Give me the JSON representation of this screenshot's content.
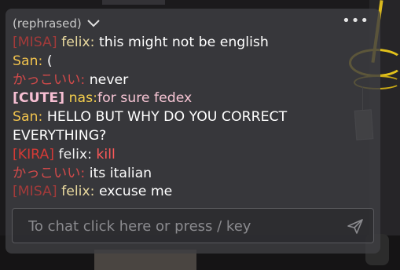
{
  "chat": {
    "header_label": "(rephrased)",
    "messages": [
      {
        "tag": "[MISA]",
        "name": "felix:",
        "text": "this might not be english"
      },
      {
        "tag": "",
        "name": "San:",
        "text": "("
      },
      {
        "tag": "",
        "name": "かっこいい:",
        "text": "never"
      },
      {
        "tag": "[CUTE]",
        "name": "nas:",
        "text": "for sure fedex"
      },
      {
        "tag": "",
        "name": "San:",
        "text": "HELLO BUT WHY DO YOU CORRECT EVERYTHING?"
      },
      {
        "tag": "[KIRA]",
        "name": "felix:",
        "text": "kill"
      },
      {
        "tag": "",
        "name": "かっこいい:",
        "text": "its italian"
      },
      {
        "tag": "[MISA]",
        "name": "felix:",
        "text": "excuse me"
      }
    ],
    "input": {
      "placeholder": "To chat click here or press / key",
      "value": ""
    }
  },
  "icons": {
    "header": "chevron-down-icon",
    "menu": "more-dots-icon",
    "send": "send-paper-plane-icon"
  },
  "colors": {
    "tag_misa": "#a23a3a",
    "tag_cute": "#f7bfd3",
    "tag_kira": "#d43a36",
    "name_felix": "#e8d89e",
    "name_san": "#f0c24d",
    "name_kakkoii": "#d44a4a",
    "name_nas": "#f5cf4d",
    "message_pink": "#f7c5d4",
    "message_red": "#ff5a5a"
  }
}
